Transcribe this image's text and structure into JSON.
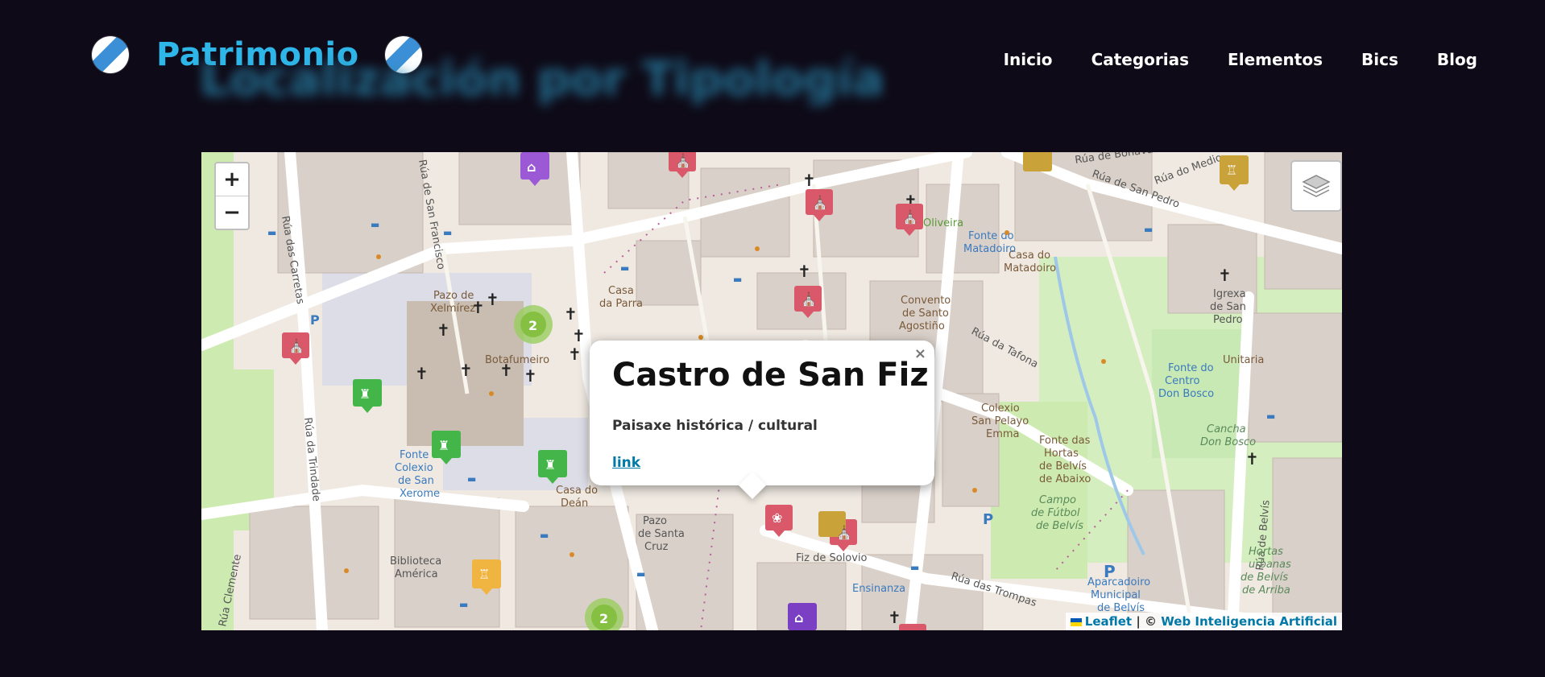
{
  "header": {
    "brand": "Patrimonio",
    "blurred_heading": "Localización por Tipología",
    "nav": [
      "Inicio",
      "Categorias",
      "Elementos",
      "Bics",
      "Blog"
    ]
  },
  "map": {
    "zoom_in": "+",
    "zoom_out": "−",
    "popup": {
      "title": "Castro de San Fiz",
      "category": "Paisaxe histórica / cultural",
      "link": "link",
      "close": "×"
    },
    "attribution": {
      "leaflet": "Leaflet",
      "separator": "| ©",
      "owner": "Web Inteligencia Artificial"
    },
    "cluster_label": "2",
    "street_labels": [
      "Rúa das Carretas",
      "Pazo de Xelmírez",
      "Botafumeiro",
      "Casa da Parra",
      "Convento de Santo Agostiño",
      "Rúa da Tafona",
      "Colexio San Pelayo Emma",
      "Fonte das Hortas de Belvís de Abaixo",
      "Campo de Fútbol de Belvís",
      "Casa do Matadoiro",
      "Igrexa de San Pedro",
      "Unitaria",
      "Fonte do Centro Don Bosco",
      "Cancha Don Bosco",
      "Rúa de Belvís",
      "Rúa das Trompas",
      "Fiz de Solovio",
      "Pazo de Santa Cruz",
      "Casa do Deán",
      "Biblioteca América",
      "Fonte Colexio de San Xerome",
      "Rúa da Trindade",
      "Aparcadoiro Municipal de Belvís",
      "Hortas urbanas de Belvís de Arriba",
      "Rúa de San Pedro",
      "Rúa do Medio",
      "Rúa de Bonaval",
      "Oliveira",
      "Fonte do Matadoiro",
      "Ensinanza",
      "Rúa Clemente",
      "Rúa de San Francisco"
    ]
  },
  "colors": {
    "background": "#0e0a17",
    "brand": "#2fb6e8",
    "link": "#0078a8",
    "marker_red": "#d9596b",
    "marker_green": "#44b549",
    "marker_purple": "#9b59d6",
    "marker_gold": "#c9a33a"
  }
}
